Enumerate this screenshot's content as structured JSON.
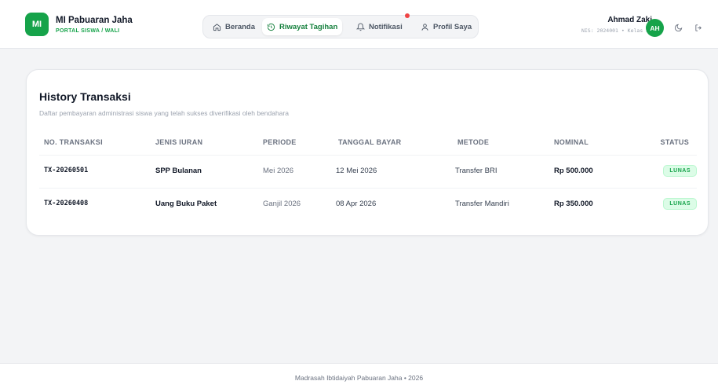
{
  "brand": {
    "logo": "MI",
    "name": "MI Pabuaran Jaha",
    "subtitle": "PORTAL SISWA / WALI",
    "accent": "#16a34a"
  },
  "nav": {
    "items": [
      {
        "label": "Beranda",
        "icon": "home-icon",
        "active": false
      },
      {
        "label": "Riwayat Tagihan",
        "icon": "history-icon",
        "active": true
      },
      {
        "label": "Notifikasi",
        "icon": "bell-icon",
        "active": false,
        "has_unread": true
      },
      {
        "label": "Profil Saya",
        "icon": "user-icon",
        "active": false
      }
    ]
  },
  "user": {
    "name": "Ahmad Zaki",
    "meta": "NIS: 2024001 • Kelas 3A",
    "initials": "AH"
  },
  "actions": {
    "theme_icon": "moon-icon",
    "logout_icon": "logout-icon"
  },
  "page": {
    "title": "History Transaksi",
    "subtitle": "Daftar pembayaran administrasi siswa yang telah sukses diverifikasi oleh bendahara"
  },
  "table": {
    "headers": [
      "NO. TRANSAKSI",
      "JENIS IURAN",
      "PERIODE",
      "TANGGAL BAYAR",
      "METODE",
      "NOMINAL",
      "STATUS"
    ],
    "rows": [
      {
        "id": "TX-20260501",
        "type": "SPP Bulanan",
        "period": "Mei 2026",
        "date": "12 Mei 2026",
        "method": "Transfer BRI",
        "amount": "Rp 500.000",
        "status": "LUNAS"
      },
      {
        "id": "TX-20260408",
        "type": "Uang Buku Paket",
        "period": "Ganjil 2026",
        "date": "08 Apr 2026",
        "method": "Transfer Mandiri",
        "amount": "Rp 350.000",
        "status": "LUNAS"
      }
    ]
  },
  "footer": {
    "text": "Madrasah Ibtidaiyah Pabuaran Jaha • 2026"
  },
  "colors": {
    "accent": "#16a34a",
    "status_paid_bg": "#dcfce7",
    "notification_dot": "#ef4444"
  }
}
